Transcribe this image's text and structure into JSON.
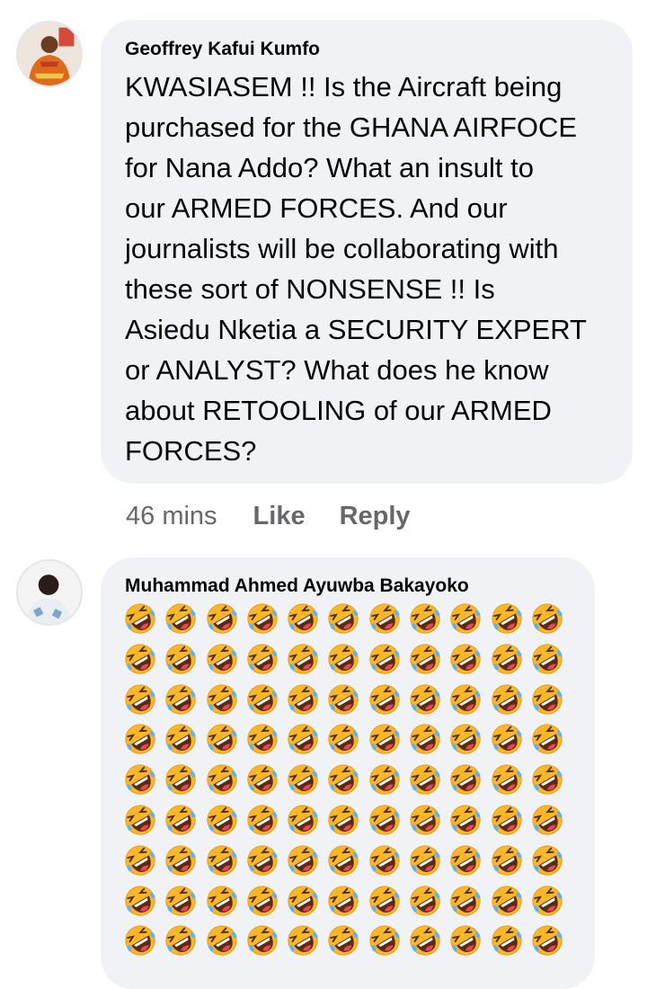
{
  "comments": [
    {
      "author": "Geoffrey Kafui Kumfo",
      "text": "KWASIASEM  !! Is the Aircraft being\npurchased for the GHANA AIRFOCE\nfor Nana Addo? What an insult to\nour ARMED FORCES. And our\njournalists will be collaborating with\nthese sort of NONSENSE  !! Is\nAsiedu Nketia a SECURITY EXPERT\nor ANALYST? What does he know\nabout RETOOLING  of our ARMED\nFORCES?",
      "time": "46 mins",
      "like_label": "Like",
      "reply_label": "Reply"
    },
    {
      "author": "Muhammad Ahmed Ayuwba Bakayoko",
      "emoji_icon": "rolling-on-floor-laughing-emoji",
      "emoji_count": 99
    }
  ],
  "colors": {
    "bubble": "#f0f2f5",
    "text": "#050505",
    "secondary": "#65676b",
    "emoji_face": "#fbb728",
    "emoji_tear": "#5fb2f0"
  }
}
